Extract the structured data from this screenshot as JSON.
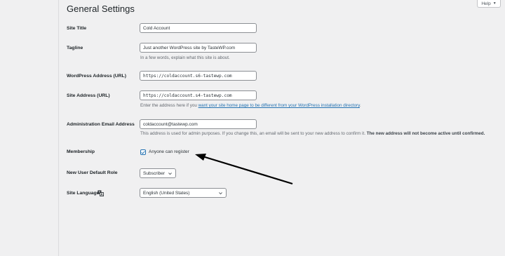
{
  "help": {
    "label": "Help",
    "caret": "▼"
  },
  "page": {
    "title": "General Settings"
  },
  "settings": {
    "site_title": {
      "label": "Site Title",
      "value": "Cold Account"
    },
    "tagline": {
      "label": "Tagline",
      "value": "Just another WordPress site by TasteWP.com",
      "description": "In a few words, explain what this site is about."
    },
    "wp_address": {
      "label": "WordPress Address (URL)",
      "value": "https://coldaccount.s6-tastewp.com"
    },
    "site_address": {
      "label": "Site Address (URL)",
      "value": "https://coldaccount.s4-tastewp.com",
      "description_prefix": "Enter the address here if you ",
      "description_link": "want your site home page to be different from your WordPress installation directory",
      "description_suffix": "."
    },
    "admin_email": {
      "label": "Administration Email Address",
      "value": "coldaccount@tastewp.com",
      "description_normal": "This address is used for admin purposes. If you change this, an email will be sent to your new address to confirm it. ",
      "description_bold": "The new address will not become active until confirmed."
    },
    "membership": {
      "label": "Membership",
      "checkbox_label": "Anyone can register",
      "checked": true
    },
    "default_role": {
      "label": "New User Default Role",
      "value": "Subscriber"
    },
    "site_language": {
      "label": "Site Language",
      "value": "English (United States)"
    }
  },
  "icons": {
    "help_caret": "chevron-down-icon",
    "checkbox": "checkmark-icon",
    "select": "chevron-down-icon",
    "language": "translation-icon",
    "annotation": "arrow-icon"
  },
  "colors": {
    "background": "#f0f0f1",
    "link": "#2271b1",
    "checkbox": "#2271b1",
    "annotation_arrow": "#000000"
  }
}
